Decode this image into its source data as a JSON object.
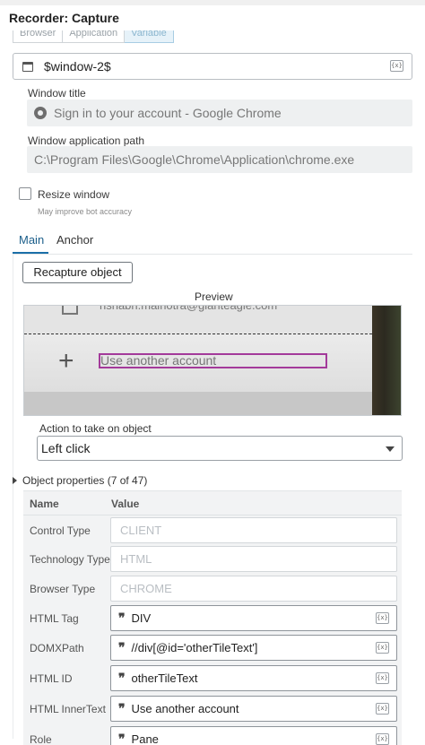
{
  "title": "Recorder: Capture",
  "segments": [
    "Browser",
    "Application",
    "Variable"
  ],
  "variable": {
    "value": "$window-2$",
    "icon": "window-icon",
    "var_button": "{x}"
  },
  "window_title": {
    "label": "Window title",
    "value": "Sign in to your account - Google Chrome",
    "icon": "chrome-icon"
  },
  "window_path": {
    "label": "Window application path",
    "value": "C:\\Program Files\\Google\\Chrome\\Application\\chrome.exe"
  },
  "resize": {
    "label": "Resize window",
    "hint": "May improve bot accuracy",
    "checked": false
  },
  "tabs": [
    "Main",
    "Anchor"
  ],
  "recapture_label": "Recapture object",
  "preview": {
    "label": "Preview",
    "email_text": "rishabh.malhotra@gianteagle.com",
    "item_text": "Use another account",
    "highlight_color": "#a33a9a"
  },
  "action": {
    "label": "Action to take on object",
    "value": "Left click"
  },
  "object_properties": {
    "title": "Object properties (7 of 47)",
    "col_name": "Name",
    "col_value": "Value",
    "rows": [
      {
        "name": "Control Type",
        "value": "CLIENT",
        "editable": false
      },
      {
        "name": "Technology Type",
        "value": "HTML",
        "editable": false
      },
      {
        "name": "Browser Type",
        "value": "CHROME",
        "editable": false
      },
      {
        "name": "HTML Tag",
        "value": "DIV",
        "editable": true
      },
      {
        "name": "DOMXPath",
        "value": "//div[@id='otherTileText']",
        "editable": true
      },
      {
        "name": "HTML ID",
        "value": "otherTileText",
        "editable": true
      },
      {
        "name": "HTML InnerText",
        "value": "Use another account",
        "editable": true
      },
      {
        "name": "Role",
        "value": "Pane",
        "editable": true
      }
    ]
  },
  "colors": {
    "accent": "#1b6fa8",
    "highlight": "#a33a9a"
  }
}
